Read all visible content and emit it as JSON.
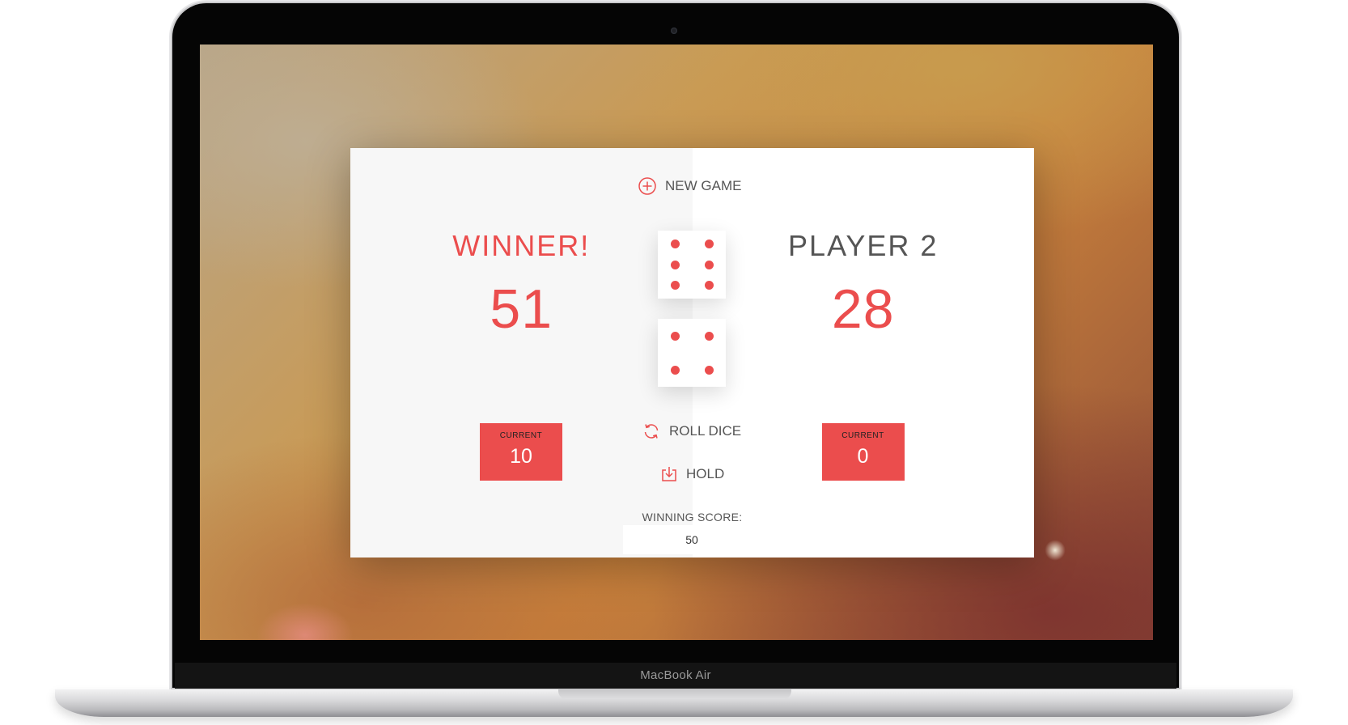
{
  "colors": {
    "accent": "#eb4d4d",
    "panel_left": "#f7f7f7",
    "panel_right": "#ffffff",
    "text": "#555555"
  },
  "controls": {
    "new_game": {
      "label": "New game",
      "icon": "plus-circle-icon"
    },
    "roll_dice": {
      "label": "Roll dice",
      "icon": "refresh-icon"
    },
    "hold": {
      "label": "Hold",
      "icon": "download-icon"
    }
  },
  "players": [
    {
      "name": "Winner!",
      "score": "51",
      "current_label": "Current",
      "current_score": "10",
      "is_winner": true
    },
    {
      "name": "Player 2",
      "score": "28",
      "current_label": "Current",
      "current_score": "0",
      "is_winner": false
    }
  ],
  "dice": [
    6,
    4
  ],
  "winning_score": {
    "label": "Winning score:",
    "value": "50"
  },
  "device": {
    "brand": "MacBook Air"
  }
}
